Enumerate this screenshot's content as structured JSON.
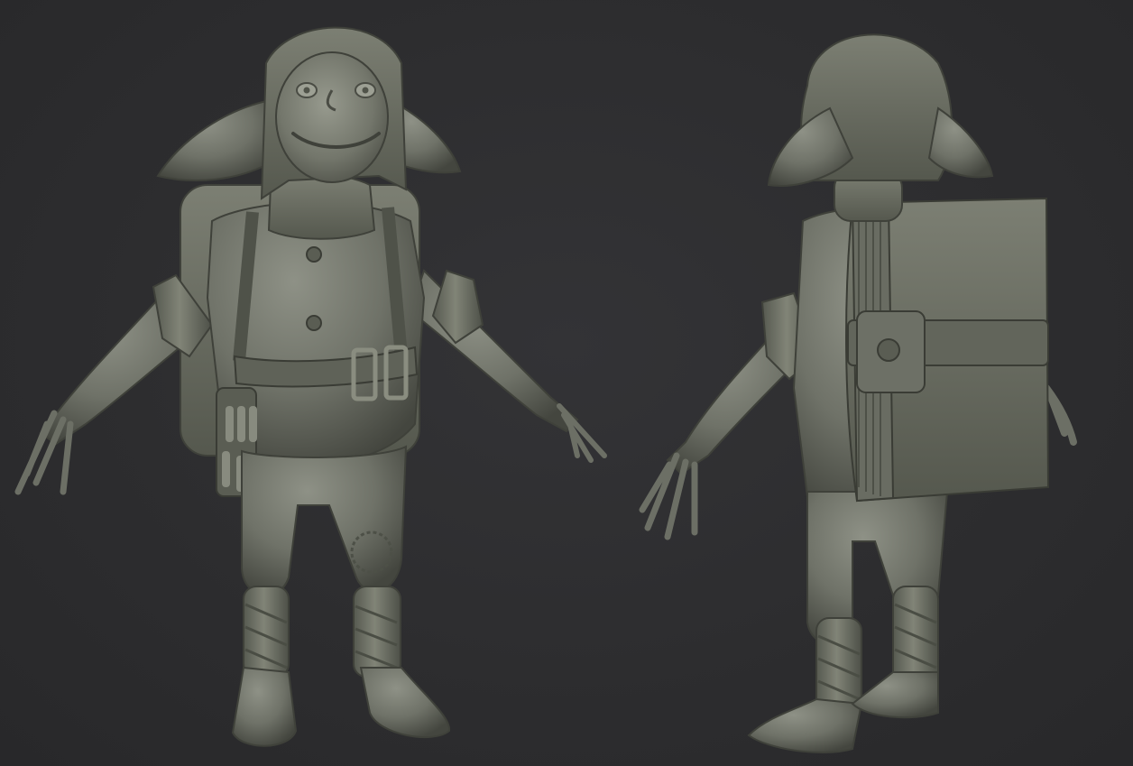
{
  "scene": {
    "background_color": "#2d2d2f",
    "clay_color": "#6f7268",
    "clay_light": "#8d9084",
    "clay_dark": "#45473f",
    "views": [
      "front-view",
      "back-three-quarter-view"
    ]
  }
}
